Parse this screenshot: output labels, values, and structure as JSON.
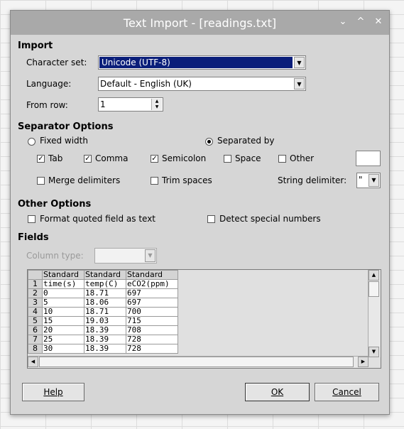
{
  "dialog": {
    "title": "Text Import - [readings.txt]",
    "title_buttons": {
      "minimize": "⌄",
      "maximize": "^",
      "close": "✕"
    }
  },
  "import": {
    "section": "Import",
    "charset_label": "Character set:",
    "charset_value": "Unicode (UTF-8)",
    "language_label": "Language:",
    "language_value": "Default - English (UK)",
    "from_row_label": "From row:",
    "from_row_value": "1"
  },
  "separator": {
    "section": "Separator Options",
    "fixed_width": "Fixed width",
    "separated_by": "Separated by",
    "fixed_width_selected": false,
    "separated_by_selected": true,
    "tab": "Tab",
    "tab_checked": true,
    "comma": "Comma",
    "comma_checked": true,
    "semicolon": "Semicolon",
    "semicolon_checked": true,
    "space": "Space",
    "space_checked": false,
    "other": "Other",
    "other_checked": false,
    "other_value": "",
    "merge_delimiters": "Merge delimiters",
    "merge_checked": false,
    "trim_spaces": "Trim spaces",
    "trim_checked": false,
    "string_delimiter_label": "String delimiter:",
    "string_delimiter_value": "\""
  },
  "other_options": {
    "section": "Other Options",
    "format_quoted": "Format quoted field as text",
    "detect_special": "Detect special numbers"
  },
  "fields": {
    "section": "Fields",
    "column_type_label": "Column type:",
    "column_type_value": "",
    "headers": [
      "Standard",
      "Standard",
      "Standard"
    ],
    "rows": [
      [
        "1",
        "time(s)",
        "temp(C)",
        "eCO2(ppm)"
      ],
      [
        "2",
        "0",
        "18.71",
        "697"
      ],
      [
        "3",
        "5",
        "18.06",
        "697"
      ],
      [
        "4",
        "10",
        "18.71",
        "700"
      ],
      [
        "5",
        "15",
        "19.03",
        "715"
      ],
      [
        "6",
        "20",
        "18.39",
        "708"
      ],
      [
        "7",
        "25",
        "18.39",
        "728"
      ],
      [
        "8",
        "30",
        "18.39",
        "728"
      ]
    ]
  },
  "buttons": {
    "help": "Help",
    "ok": "OK",
    "cancel": "Cancel"
  },
  "colors": {
    "selection": "#0a1e7a",
    "titlebar": "#a9a9a9",
    "dialog_bg": "#d6d6d6"
  }
}
